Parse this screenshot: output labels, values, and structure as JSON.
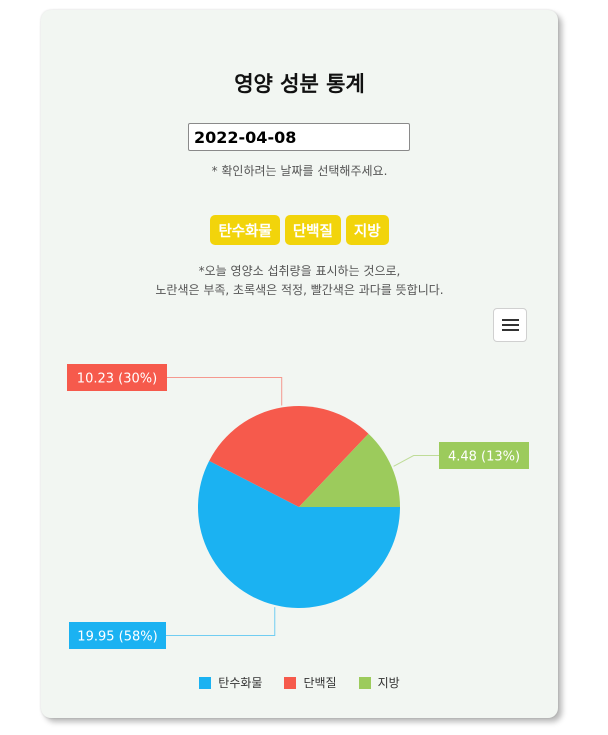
{
  "page": {
    "title": "영양 성분 통계",
    "date_value": "2022-04-08",
    "date_hint": "* 확인하려는 날짜를 선택해주세요.",
    "description_line1": "*오늘 영양소 섭취량을 표시하는 것으로,",
    "description_line2": "노란색은 부족, 초록색은 적정, 빨간색은 과다를 뜻합니다."
  },
  "buttons": [
    {
      "label": "탄수화물"
    },
    {
      "label": "단백질"
    },
    {
      "label": "지방"
    }
  ],
  "menu": {
    "icon": "hamburger-menu-icon"
  },
  "colors": {
    "button_yellow": "#f2d40b",
    "carbohydrate": "#1bb2f2",
    "protein": "#f65a4c",
    "fat": "#9ccb5c"
  },
  "chart_data": {
    "type": "pie",
    "categories": [
      "탄수화물",
      "단백질",
      "지방"
    ],
    "values": [
      19.95,
      10.23,
      4.48
    ],
    "data_labels": [
      "19.95 (58%)",
      "10.23 (30%)",
      "4.48 (13%)"
    ],
    "colors": [
      "#1bb2f2",
      "#f65a4c",
      "#9ccb5c"
    ],
    "legend": "bottom"
  }
}
